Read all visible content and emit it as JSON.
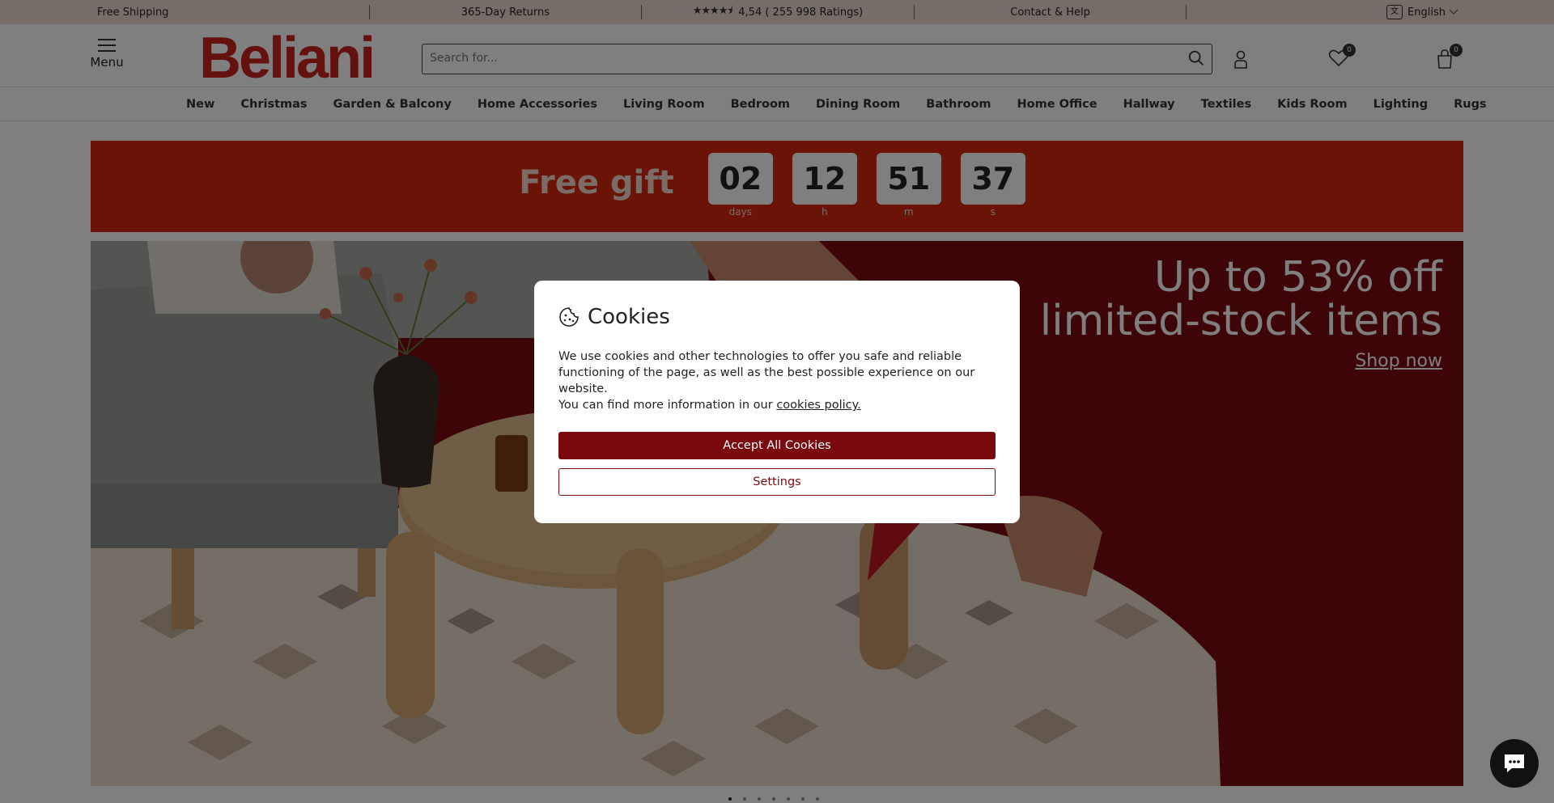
{
  "topbar": {
    "shipping": "Free Shipping",
    "returns": "365-Day Returns",
    "rating_stars": "★★★★⯨",
    "rating_text": "4,54 ( 255 998 Ratings)",
    "contact": "Contact & Help",
    "language": "English"
  },
  "header": {
    "menu_label": "Menu",
    "logo": "Beliani",
    "search_placeholder": "Search for...",
    "wishlist_count": "0",
    "cart_count": "0"
  },
  "nav": {
    "items": [
      "New",
      "Christmas",
      "Garden & Balcony",
      "Home Accessories",
      "Living Room",
      "Bedroom",
      "Dining Room",
      "Bathroom",
      "Home Office",
      "Hallway",
      "Textiles",
      "Kids Room",
      "Lighting",
      "Rugs"
    ]
  },
  "promo": {
    "label": "Free gift",
    "days": "02",
    "days_unit": "days",
    "hours": "12",
    "hours_unit": "h",
    "minutes": "51",
    "minutes_unit": "m",
    "seconds": "37",
    "seconds_unit": "s"
  },
  "hero": {
    "line1": "Up to 53% off",
    "line2": "limited-stock items",
    "cta": "Shop now"
  },
  "cookies": {
    "title": "Cookies",
    "text1": "We use cookies and other technologies to offer you safe and reliable functioning of the page, as well as the best possible experience on our website.",
    "text2": "You can find more information in our",
    "link": "cookies policy.",
    "accept": "Accept All Cookies",
    "settings": "Settings"
  },
  "colors": {
    "brand": "#c8231f",
    "promo_bg": "#d6270f",
    "hero_bg": "#7a0b0f",
    "accept_bg": "#7a0a0e",
    "topbar_bg": "#eddbd3"
  },
  "icons": [
    "menu-icon",
    "search-icon",
    "user-icon",
    "heart-icon",
    "cart-icon",
    "language-icon",
    "cookie-icon",
    "chat-icon",
    "chevron-down-icon",
    "star-icon"
  ]
}
